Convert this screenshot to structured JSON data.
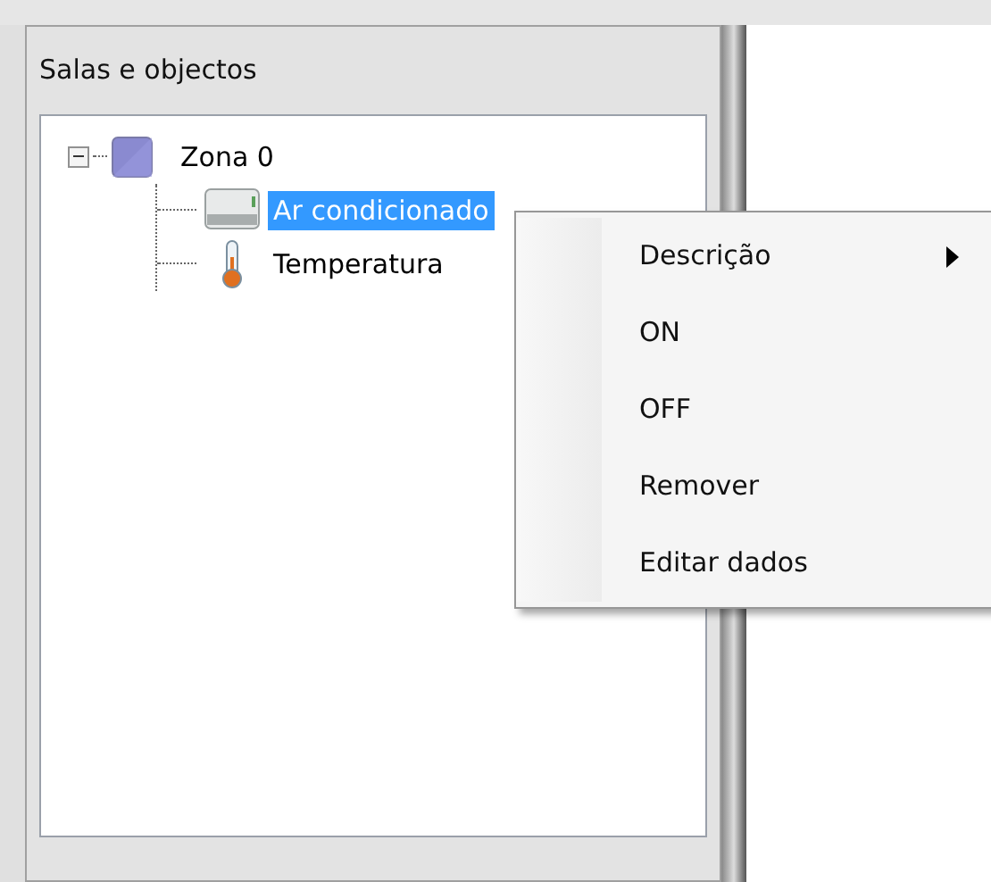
{
  "panel": {
    "title": "Salas e objectos"
  },
  "tree": [
    {
      "label": "Zona 0",
      "kind": "zone",
      "expanded": true,
      "selected": false,
      "children": [
        {
          "label": "Ar condicionado",
          "kind": "ac",
          "selected": true
        },
        {
          "label": "Temperatura",
          "kind": "thermo",
          "selected": false
        }
      ]
    }
  ],
  "context_menu": [
    {
      "label": "Descrição",
      "submenu": true
    },
    {
      "label": "ON",
      "submenu": false
    },
    {
      "label": "OFF",
      "submenu": false
    },
    {
      "label": "Remover",
      "submenu": false
    },
    {
      "label": "Editar dados",
      "submenu": false
    }
  ]
}
